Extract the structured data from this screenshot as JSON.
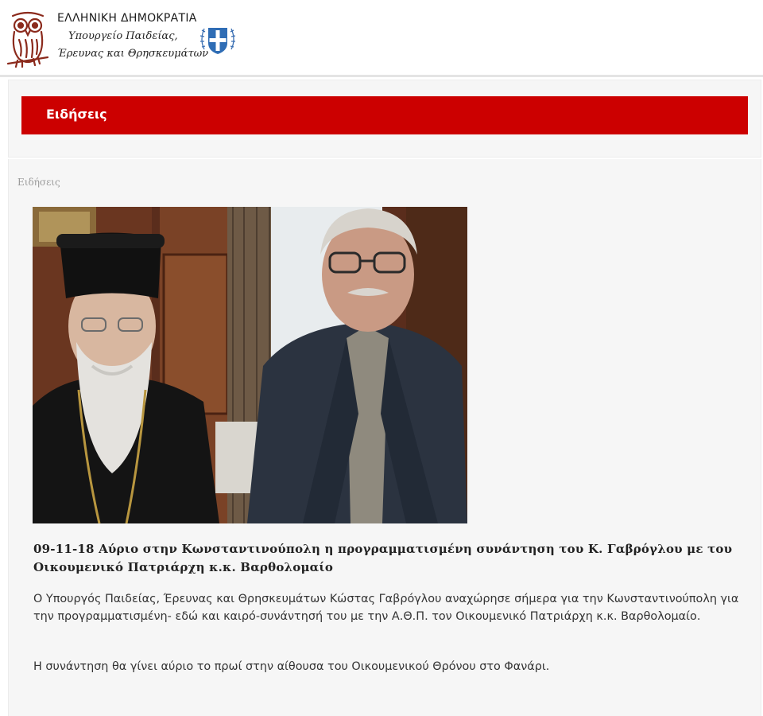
{
  "header": {
    "org_name": "ΕΛΛΗΝΙΚΗ ΔΗΜΟΚΡΑΤΙΑ",
    "ministry_line1": "Υπουργείο Παιδείας,",
    "ministry_line2": "Έρευνας και Θρησκευμάτων",
    "logo_icon": "owl-logo-icon",
    "emblem_icon": "greek-coat-of-arms-icon",
    "accent_color": "#8b2a1c"
  },
  "banner": {
    "title": "Ειδήσεις",
    "color": "#cc0000"
  },
  "breadcrumb": {
    "text": "Ειδήσεις"
  },
  "article": {
    "title": "09-11-18 Αύριο στην Κωνσταντινούπολη η προγραμματισμένη συνάντηση του Κ. Γαβρόγλου με του Οικουμενικό Πατριάρχη κ.κ. Βαρθολομαίο",
    "paragraphs": [
      "Ο Υπουργός Παιδείας, Έρευνας και Θρησκευμάτων Κώστας Γαβρόγλου αναχώρησε σήμερα για την Κωνσταντινούπολη για την προγραμματισμένη- εδώ και καιρό-συνάντησή του με την Α.Θ.Π. τον Οικουμενικό Πατριάρχη κ.κ. Βαρθολομαίο.",
      "Η συνάντηση θα γίνει αύριο το πρωί στην αίθουσα του Οικουμενικού Θρόνου στο Φανάρι."
    ]
  }
}
